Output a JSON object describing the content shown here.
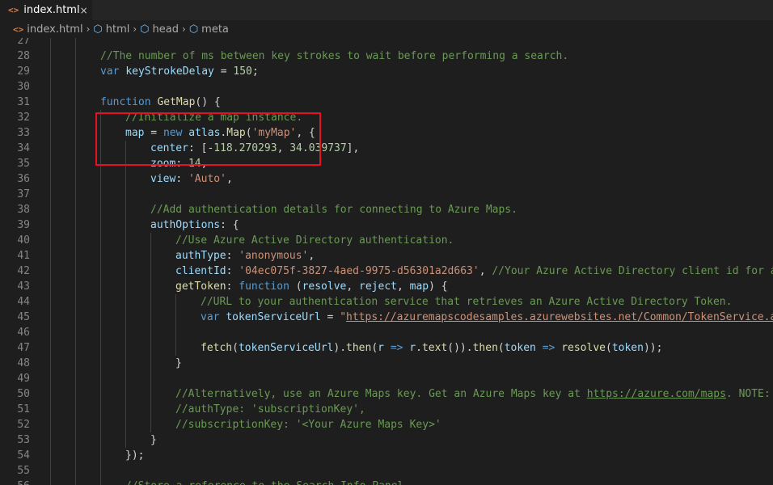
{
  "tab": {
    "label": "index.html",
    "icon": "html-file-icon",
    "close": "×"
  },
  "breadcrumb": [
    {
      "label": "index.html",
      "icon": "html-file-icon"
    },
    {
      "label": "html",
      "icon": "cube-icon"
    },
    {
      "label": "head",
      "icon": "cube-icon"
    },
    {
      "label": "meta",
      "icon": "cube-icon"
    }
  ],
  "lines": [
    {
      "n": "27",
      "indent": 0,
      "tokens": []
    },
    {
      "n": "28",
      "indent": 2,
      "tokens": [
        [
          "c-com",
          "//The number of ms between key strokes to wait before performing a search."
        ]
      ]
    },
    {
      "n": "29",
      "indent": 2,
      "tokens": [
        [
          "c-kw",
          "var "
        ],
        [
          "c-var",
          "keyStrokeDelay"
        ],
        [
          "c-pl",
          " = "
        ],
        [
          "c-num",
          "150"
        ],
        [
          "c-pl",
          ";"
        ]
      ]
    },
    {
      "n": "30",
      "indent": 0,
      "tokens": []
    },
    {
      "n": "31",
      "indent": 2,
      "tokens": [
        [
          "c-kw",
          "function "
        ],
        [
          "c-fn",
          "GetMap"
        ],
        [
          "c-pl",
          "() {"
        ]
      ]
    },
    {
      "n": "32",
      "indent": 3,
      "tokens": [
        [
          "c-com",
          "//Initialize a map instance."
        ]
      ]
    },
    {
      "n": "33",
      "indent": 3,
      "tokens": [
        [
          "c-var",
          "map"
        ],
        [
          "c-pl",
          " = "
        ],
        [
          "c-kw",
          "new "
        ],
        [
          "c-var",
          "atlas"
        ],
        [
          "c-pl",
          "."
        ],
        [
          "c-fn",
          "Map"
        ],
        [
          "c-pl",
          "("
        ],
        [
          "c-str",
          "'myMap'"
        ],
        [
          "c-pl",
          ", {"
        ]
      ]
    },
    {
      "n": "34",
      "indent": 4,
      "tokens": [
        [
          "c-var",
          "center"
        ],
        [
          "c-pl",
          ": [-"
        ],
        [
          "c-num",
          "118.270293"
        ],
        [
          "c-pl",
          ", "
        ],
        [
          "c-num",
          "34.039737"
        ],
        [
          "c-pl",
          "],"
        ]
      ]
    },
    {
      "n": "35",
      "indent": 4,
      "tokens": [
        [
          "c-var",
          "zoom"
        ],
        [
          "c-pl",
          ": "
        ],
        [
          "c-num",
          "14"
        ],
        [
          "c-pl",
          ","
        ]
      ]
    },
    {
      "n": "36",
      "indent": 4,
      "tokens": [
        [
          "c-var",
          "view"
        ],
        [
          "c-pl",
          ": "
        ],
        [
          "c-str",
          "'Auto'"
        ],
        [
          "c-pl",
          ","
        ]
      ]
    },
    {
      "n": "37",
      "indent": 0,
      "tokens": []
    },
    {
      "n": "38",
      "indent": 4,
      "tokens": [
        [
          "c-com",
          "//Add authentication details for connecting to Azure Maps."
        ]
      ]
    },
    {
      "n": "39",
      "indent": 4,
      "tokens": [
        [
          "c-var",
          "authOptions"
        ],
        [
          "c-pl",
          ": {"
        ]
      ]
    },
    {
      "n": "40",
      "indent": 5,
      "tokens": [
        [
          "c-com",
          "//Use Azure Active Directory authentication."
        ]
      ]
    },
    {
      "n": "41",
      "indent": 5,
      "tokens": [
        [
          "c-var",
          "authType"
        ],
        [
          "c-pl",
          ": "
        ],
        [
          "c-str",
          "'anonymous'"
        ],
        [
          "c-pl",
          ","
        ]
      ]
    },
    {
      "n": "42",
      "indent": 5,
      "tokens": [
        [
          "c-var",
          "clientId"
        ],
        [
          "c-pl",
          ": "
        ],
        [
          "c-str",
          "'04ec075f-3827-4aed-9975-d56301a2d663'"
        ],
        [
          "c-pl",
          ", "
        ],
        [
          "c-com",
          "//Your Azure Active Directory client id for ac"
        ]
      ]
    },
    {
      "n": "43",
      "indent": 5,
      "tokens": [
        [
          "c-fn",
          "getToken"
        ],
        [
          "c-pl",
          ": "
        ],
        [
          "c-kw",
          "function "
        ],
        [
          "c-pl",
          "("
        ],
        [
          "c-var",
          "resolve"
        ],
        [
          "c-pl",
          ", "
        ],
        [
          "c-var",
          "reject"
        ],
        [
          "c-pl",
          ", "
        ],
        [
          "c-var",
          "map"
        ],
        [
          "c-pl",
          ") {"
        ]
      ]
    },
    {
      "n": "44",
      "indent": 6,
      "tokens": [
        [
          "c-com",
          "//URL to your authentication service that retrieves an Azure Active Directory Token."
        ]
      ]
    },
    {
      "n": "45",
      "indent": 6,
      "tokens": [
        [
          "c-kw",
          "var "
        ],
        [
          "c-var",
          "tokenServiceUrl"
        ],
        [
          "c-pl",
          " = "
        ],
        [
          "c-str",
          "\""
        ],
        [
          "c-url",
          "https://azuremapscodesamples.azurewebsites.net/Common/TokenService.as"
        ]
      ]
    },
    {
      "n": "46",
      "indent": 0,
      "tokens": []
    },
    {
      "n": "47",
      "indent": 6,
      "tokens": [
        [
          "c-fn",
          "fetch"
        ],
        [
          "c-pl",
          "("
        ],
        [
          "c-var",
          "tokenServiceUrl"
        ],
        [
          "c-pl",
          ")."
        ],
        [
          "c-fn",
          "then"
        ],
        [
          "c-pl",
          "("
        ],
        [
          "c-var",
          "r"
        ],
        [
          "c-kw",
          " => "
        ],
        [
          "c-var",
          "r"
        ],
        [
          "c-pl",
          "."
        ],
        [
          "c-fn",
          "text"
        ],
        [
          "c-pl",
          "())."
        ],
        [
          "c-fn",
          "then"
        ],
        [
          "c-pl",
          "("
        ],
        [
          "c-var",
          "token"
        ],
        [
          "c-kw",
          " => "
        ],
        [
          "c-fn",
          "resolve"
        ],
        [
          "c-pl",
          "("
        ],
        [
          "c-var",
          "token"
        ],
        [
          "c-pl",
          "));"
        ]
      ]
    },
    {
      "n": "48",
      "indent": 5,
      "tokens": [
        [
          "c-pl",
          "}"
        ]
      ]
    },
    {
      "n": "49",
      "indent": 0,
      "tokens": []
    },
    {
      "n": "50",
      "indent": 5,
      "tokens": [
        [
          "c-com",
          "//Alternatively, use an Azure Maps key. Get an Azure Maps key at "
        ],
        [
          "c-link",
          "https://azure.com/maps"
        ],
        [
          "c-com",
          ". NOTE: T"
        ]
      ]
    },
    {
      "n": "51",
      "indent": 5,
      "tokens": [
        [
          "c-com",
          "//authType: 'subscriptionKey',"
        ]
      ]
    },
    {
      "n": "52",
      "indent": 5,
      "tokens": [
        [
          "c-com",
          "//subscriptionKey: '<Your Azure Maps Key>'"
        ]
      ]
    },
    {
      "n": "53",
      "indent": 4,
      "tokens": [
        [
          "c-pl",
          "}"
        ]
      ]
    },
    {
      "n": "54",
      "indent": 3,
      "tokens": [
        [
          "c-pl",
          "});"
        ]
      ]
    },
    {
      "n": "55",
      "indent": 0,
      "tokens": []
    },
    {
      "n": "56",
      "indent": 3,
      "tokens": [
        [
          "c-com",
          "//Store a reference to the Search Info Panel."
        ]
      ]
    }
  ]
}
